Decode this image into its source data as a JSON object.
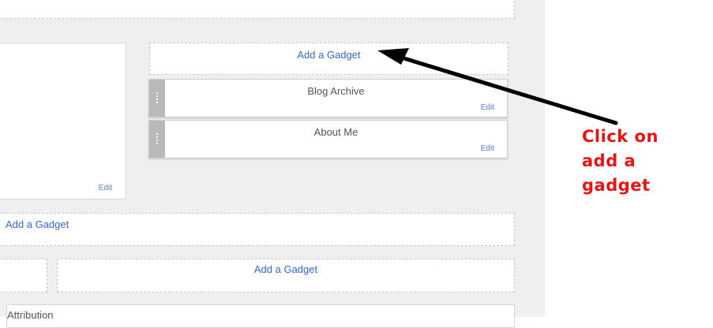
{
  "layout_editor": {
    "add_gadget_label": "Add a Gadget",
    "sidebar_gadgets": [
      {
        "title": "Blog Archive",
        "edit_label": "Edit"
      },
      {
        "title": "About Me",
        "edit_label": "Edit"
      }
    ],
    "main_edit_label": "Edit",
    "attribution_title": "Attribution"
  },
  "annotation": {
    "text_lines": [
      "Click on",
      "add a",
      "gadget"
    ],
    "text_color": "#ee1111",
    "arrow_color": "#000000"
  }
}
